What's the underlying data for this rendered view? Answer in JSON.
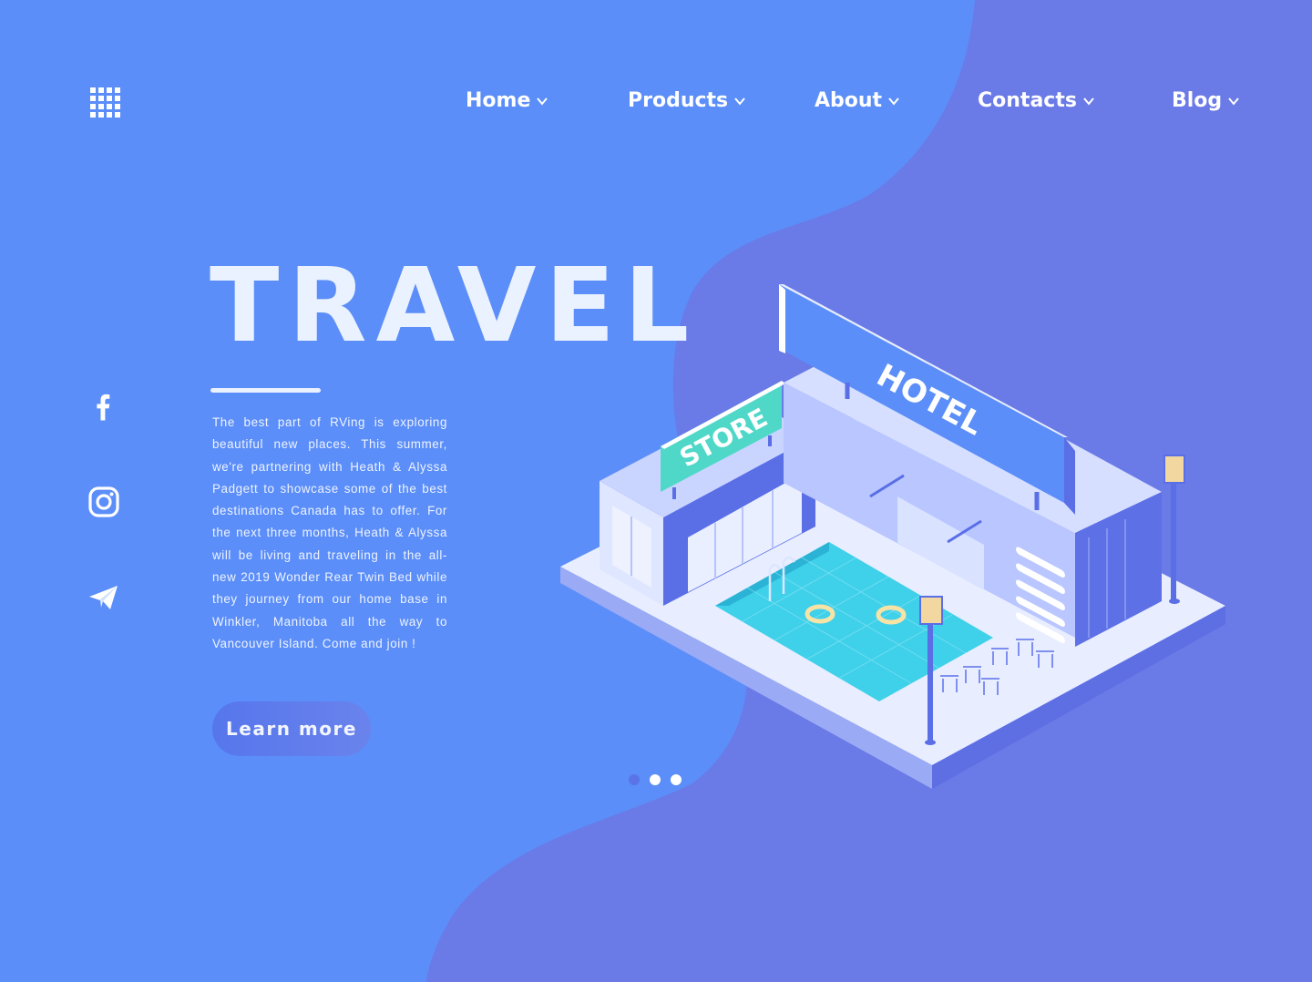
{
  "colors": {
    "background": "#5b8ef9",
    "blob": "#6a7ae6",
    "text": "#ffffff",
    "accent_button": "#5676ec"
  },
  "menu_icon": "grid-menu-icon",
  "nav": {
    "items": [
      {
        "label": "Home"
      },
      {
        "label": "Products"
      },
      {
        "label": "About"
      },
      {
        "label": "Contacts"
      },
      {
        "label": "Blog"
      }
    ]
  },
  "hero": {
    "title": "TRAVEL",
    "description": "The best part of RVing is exploring beautiful new places. This summer, we're partnering with Heath & Alyssa Padgett to showcase some of the best destinations Canada has to offer. For the next three months, Heath & Alyssa will be living and traveling in the all-new 2019 Wonder Rear Twin Bed while they journey from our home base in Winkler, Manitoba all the way to Vancouver Island.  Come and join !",
    "button_label": "Learn more"
  },
  "social": [
    "facebook-icon",
    "instagram-icon",
    "paper-plane-icon"
  ],
  "carousel": {
    "slides": 3,
    "active": 1
  },
  "illustration": {
    "store_sign": "STORE",
    "hotel_sign": "HOTEL"
  }
}
